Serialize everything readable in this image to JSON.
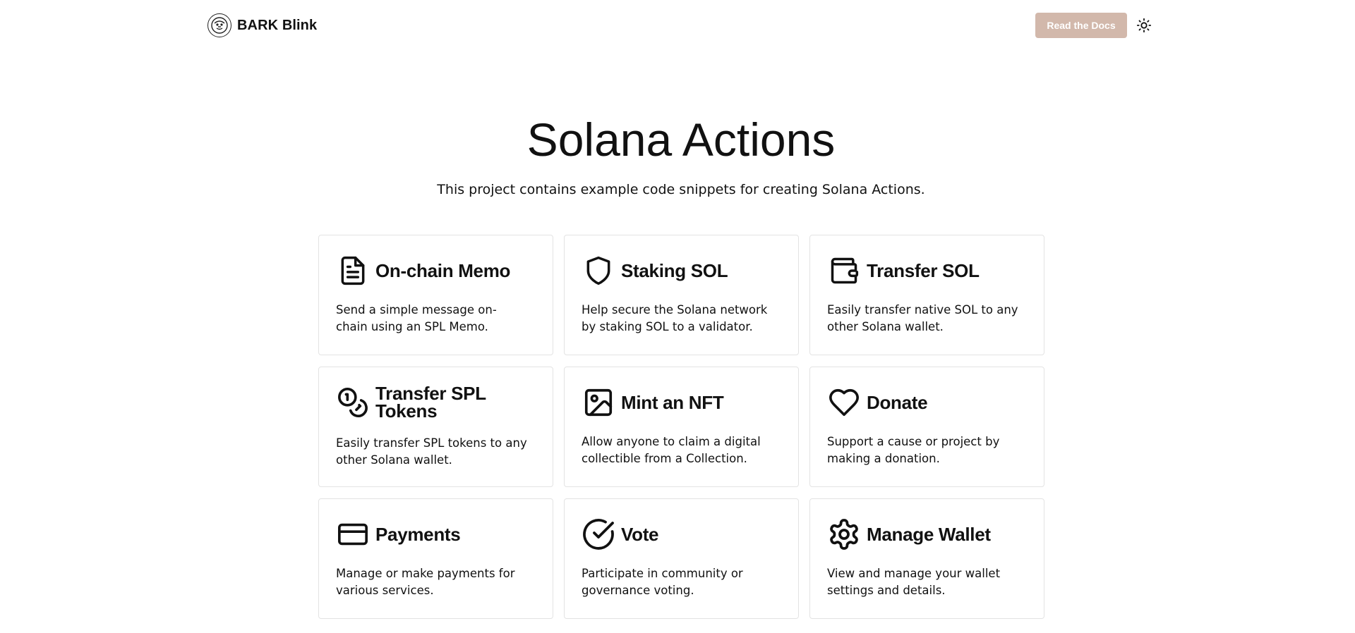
{
  "header": {
    "brand_name": "BARK Blink",
    "docs_button_label": "Read the Docs",
    "icons": {
      "logo": "bark-logo-icon",
      "theme": "sun-icon"
    }
  },
  "hero": {
    "title": "Solana Actions",
    "subtitle": "This project contains example code snippets for creating Solana Actions."
  },
  "cards": [
    {
      "title": "On-chain Memo",
      "description": "Send a simple message on-chain using an SPL Memo.",
      "icon": "document-icon"
    },
    {
      "title": "Staking SOL",
      "description": "Help secure the Solana network by staking SOL to a validator.",
      "icon": "shield-icon"
    },
    {
      "title": "Transfer SOL",
      "description": "Easily transfer native SOL to any other Solana wallet.",
      "icon": "wallet-icon"
    },
    {
      "title": "Transfer SPL Tokens",
      "description": "Easily transfer SPL tokens to any other Solana wallet.",
      "icon": "coins-icon"
    },
    {
      "title": "Mint an NFT",
      "description": "Allow anyone to claim a digital collectible from a Collection.",
      "icon": "image-icon"
    },
    {
      "title": "Donate",
      "description": "Support a cause or project by making a donation.",
      "icon": "heart-icon"
    },
    {
      "title": "Payments",
      "description": "Manage or make payments for various services.",
      "icon": "credit-card-icon"
    },
    {
      "title": "Vote",
      "description": "Participate in community or governance voting.",
      "icon": "check-circle-icon"
    },
    {
      "title": "Manage Wallet",
      "description": "View and manage your wallet settings and details.",
      "icon": "gear-icon"
    }
  ],
  "colors": {
    "docs_button_bg": "#d2b8ab",
    "text": "#111111",
    "card_border": "#e3e3e3"
  }
}
